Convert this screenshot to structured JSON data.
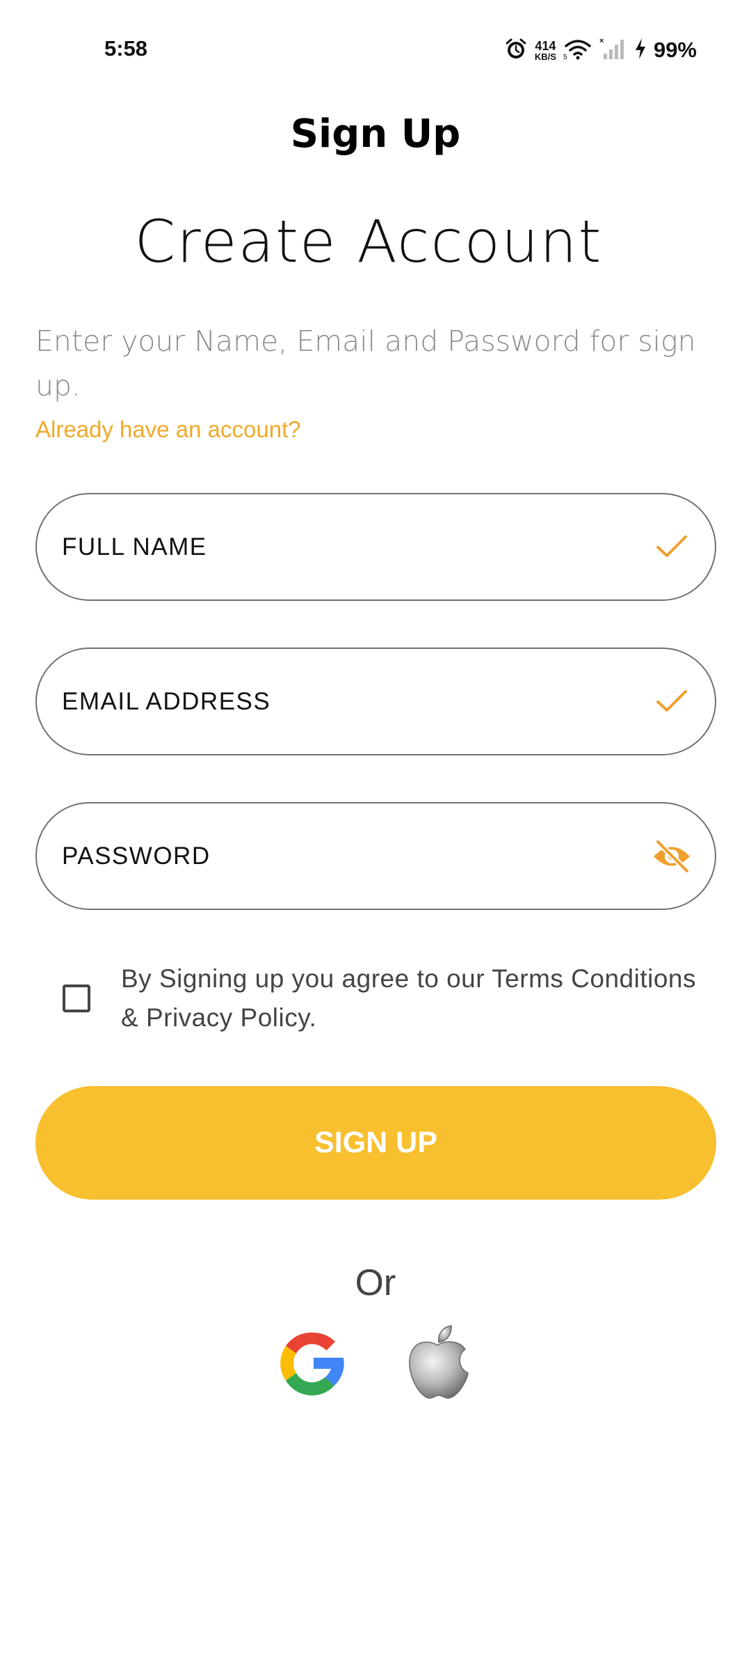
{
  "status_bar": {
    "time": "5:58",
    "net_speed_value": "414",
    "net_speed_unit": "KB/S",
    "battery": "99%",
    "icons": [
      "alarm-icon",
      "wifi-icon",
      "cellular-signal-icon",
      "charging-icon"
    ]
  },
  "header": {
    "title": "Sign Up"
  },
  "main": {
    "heading": "Create Account",
    "subtitle": "Enter your Name, Email and Password for sign up.",
    "signin_link": "Already have an account?"
  },
  "form": {
    "full_name": {
      "placeholder": "FULL NAME",
      "value": "",
      "status_icon": "check-icon"
    },
    "email": {
      "placeholder": "EMAIL ADDRESS",
      "value": "",
      "status_icon": "check-icon"
    },
    "password": {
      "placeholder": "PASSWORD",
      "value": "",
      "toggle_icon": "eye-off-icon"
    },
    "terms_checked": false,
    "terms_text": "By Signing up you agree to our Terms Conditions & Privacy Policy.",
    "submit_label": "SIGN UP"
  },
  "alt_login": {
    "divider_text": "Or",
    "providers": [
      "google-icon",
      "apple-icon"
    ]
  },
  "colors": {
    "accent": "#f8bf2e",
    "link": "#f0a92a",
    "icon_orange": "#f0a02e",
    "border": "#707070",
    "subtle_text": "#8a8a8a"
  }
}
